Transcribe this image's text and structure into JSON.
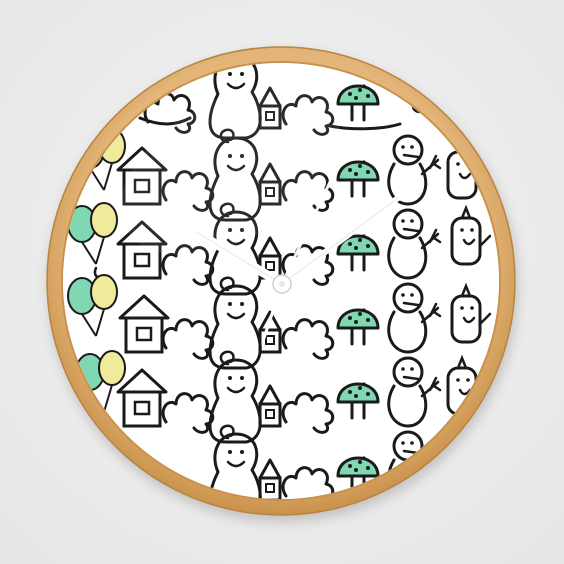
{
  "image": {
    "subject": "wall-clock",
    "colors": {
      "background": "#ececec",
      "frame": "#d9a766",
      "frame_dark": "#b8843f",
      "face": "#ffffff",
      "ink": "#1a1a1a",
      "mint": "#7fd8b2",
      "mint_dark": "#3fae86",
      "pale_yellow": "#f0eb9a",
      "hands": "#ffffff"
    },
    "clock_time_shown": {
      "hour_hand": "10",
      "minute_hand": "2"
    }
  }
}
